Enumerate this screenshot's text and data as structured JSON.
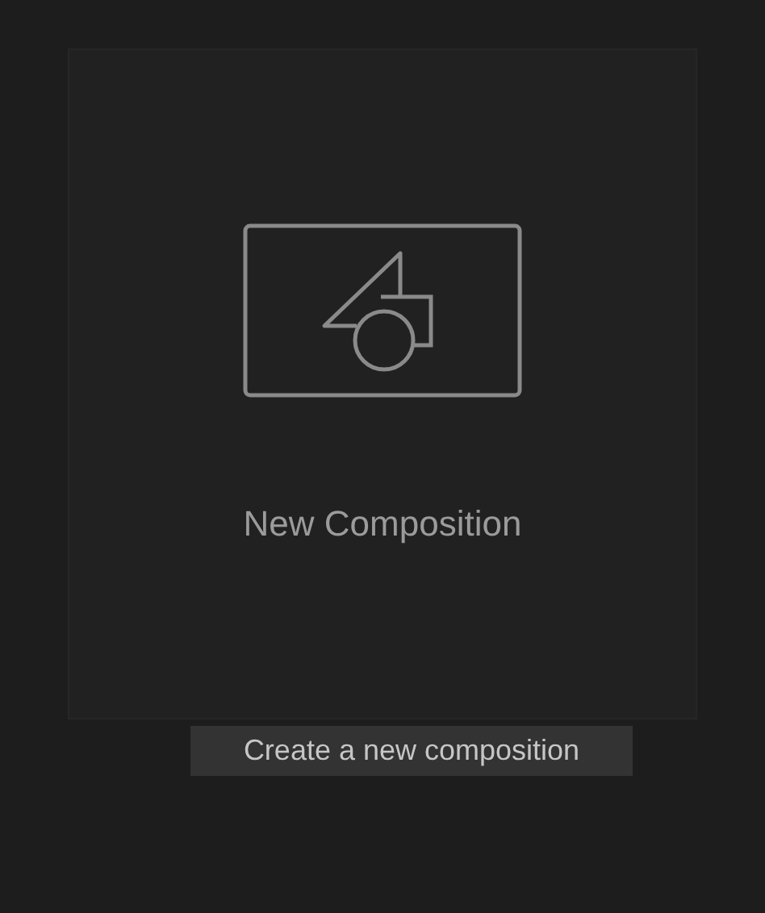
{
  "card": {
    "title": "New Composition"
  },
  "tooltip": {
    "text": "Create a new composition"
  }
}
